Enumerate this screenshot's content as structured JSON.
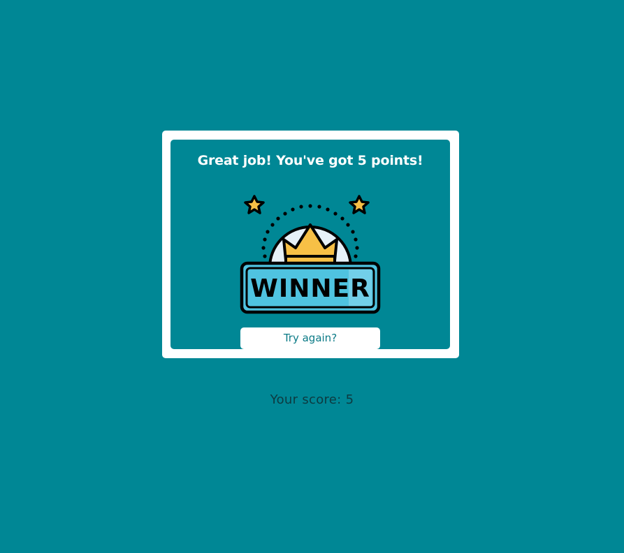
{
  "result_card": {
    "message": "Great job! You've got 5 points!",
    "badge": {
      "icon": "winner-crown-badge",
      "text": "WINNER"
    },
    "try_again_label": "Try again?"
  },
  "score": {
    "label": "Your score: 5"
  },
  "colors": {
    "background": "#008795",
    "card_border": "#ffffff",
    "badge_banner": "#4fc3e0",
    "crown": "#f7c046",
    "star": "#f7c046"
  }
}
